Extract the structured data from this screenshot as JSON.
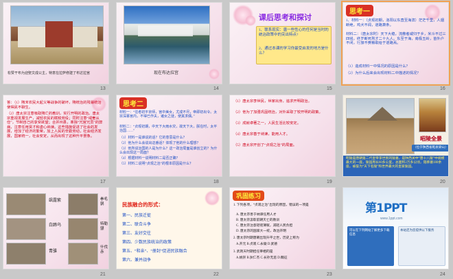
{
  "slides": [
    {
      "number": "13",
      "caption": "松赞干布为迎娶文成公主，特意在拉萨修建了布达拉宫"
    },
    {
      "number": "14",
      "caption": "现在布达拉宫"
    },
    {
      "number": "15",
      "title": "课后思考和探讨",
      "q1": "1、联系现实：唐一些性心的任何是当时的统治政策中的突出特点?",
      "q2": "2、通过本课的学习你最受启发的地方是什么？"
    },
    {
      "number": "16",
      "title": "思考一",
      "material1_label": "1、材料一：",
      "material1_text": "（贞观初期，洛阳以东直至海滨）茫茫千里，人烟断绝，鸡犬不闻，道路萧条。",
      "material2_label": "材料二：",
      "material2_text": "（唐太宗时）天下大稳，流散者咸归于乡，米斗不过三四钱，终岁断死刑才二十九人。东至于海，南极五岭，皆外户不闭，行旅不赍粮取给于道路焉。",
      "q1": "（1）造成材料一中情况的原因是什么？",
      "q2": "（2）为什么后来会出现材料二中描述的情况？"
    },
    {
      "number": "17",
      "answer1": "答：（1）隋末农民大起义等战争的破坏，隋统治的残暴统治使得民不聊生。",
      "answer2": "（2）唐太宗注意吸取隋亡的教训，实行开明的政治。唐太宗重视发展生产，减轻农民的赋税劳役；同时注意“戒奢从俭”，节制自己的享受欲望；合并州县，革除“冗官冗员”的弊病，注意任用贤才和虚心纳谏。这些措施促进了社会的发展，增加了经济的繁荣，加上人民的辛勤劳动，社会经济发展，国家统一，社会安定，从而出现了这种升平景象。"
    },
    {
      "number": "18",
      "title": "思考二",
      "material1_label": "材料一：",
      "material1_text": "“往者初平京师，宫中美女，尤成不尽，帝即初出令。太宗深慕宫内，不得已作夫，诸女之徒，使其求偶。”",
      "material2_label": "材料二：",
      "material2_text": "“贞观初期，中天下大雨水灾，故天下大，朕在时，太平治国……”",
      "q1": "（1）材料一是谁说的话？它的意思是什么？",
      "q2": "（2）他为什么会说出这番话？体现了他的什么理想？",
      "q3": "（3）他所说治国的人是为什么？这一政治局面是谁创立的？为什么会出现这一局面？",
      "q4": "（4）根据材料一说明材料二是否正确？",
      "q5": "（5）材料二说明“贞观之治”的根本原因是什么？"
    },
    {
      "number": "19",
      "line1": "（1）唐太宗李世民，世家出身，追求开明政治。",
      "line2": "（2）他为了加强巩固统治，对外采取了较开明的政策。",
      "line3": "（3）成就卓著之一，人民生活比较安定。",
      "line4": "（4）唐太宗善于纳谏，能用人才。",
      "line5": "（5）唐太宗开创了“贞观之治”的局面。"
    },
    {
      "number": "20",
      "name_label": "昭陵全景",
      "location": "（位于陕西省乾县梁山）",
      "desc": "昭陵是唐朝第二代皇帝李世民的陵墓，是陕西关中“唐十八陵”中规模最大的一座，陵园周长60多公里，总面积2万多公顷，陪葬墓180余座，被誉为“天下名陵”和世界最大的皇家陵园。"
    },
    {
      "number": "21",
      "horse1": "飒露紫",
      "horse2": "拳毛䯄",
      "horse3": "白蹄乌",
      "horse4": "特勒骠",
      "horse5": "青骓",
      "horse6": "什伐赤"
    },
    {
      "number": "22",
      "title": "民族融合的形式：",
      "items": [
        "第一、民族迁徙",
        "第二、联合斗争",
        "第三、友好交往",
        "第四、少数民族统治的政策",
        "第五、“和亲”、“册封”促进民族融合",
        "第六、兼并战争"
      ]
    },
    {
      "number": "23",
      "title": "巩固练习",
      "q1": "1. 下列各项，“贞观之治”出现的原因，错误的一项是",
      "opt_a": "A. 唐太宗善于纳谏任用人才",
      "opt_b": "B. 唐太宗汲取前朝灭亡的教训",
      "opt_c": "C. 唐太宗注意轻徭薄赋，减轻人民负担",
      "opt_d": "D. 唐太宗的国家大一统，政治开明",
      "q2": "2. 唐太宗时期唐朝出现升平之世，历史上称为",
      "opts2": "A.开元   B.贞观   C.永徽   D.武德",
      "q3": "3. 武则天时期担任宰相的是",
      "opts3": "A.姚崇   B.狄仁杰   C.长孙无忌   D.魏征"
    },
    {
      "number": "24",
      "logo_main": "第1PPT",
      "logo_sub": "www.1ppt.com",
      "left_info": "可以在下列网站了解更多下载信息",
      "right_info": "本站还为您提供以下服务"
    }
  ],
  "colors": {
    "background": "#c9c9c9",
    "slide_border": "#d9d9d9",
    "accent_red": "#d93025",
    "accent_yellow": "#ffeb3b",
    "text_blue": "#1d4fc4",
    "text_red": "#d0021b",
    "pink": "#f6e2ec",
    "ppt_blue": "#1f6fc4"
  }
}
